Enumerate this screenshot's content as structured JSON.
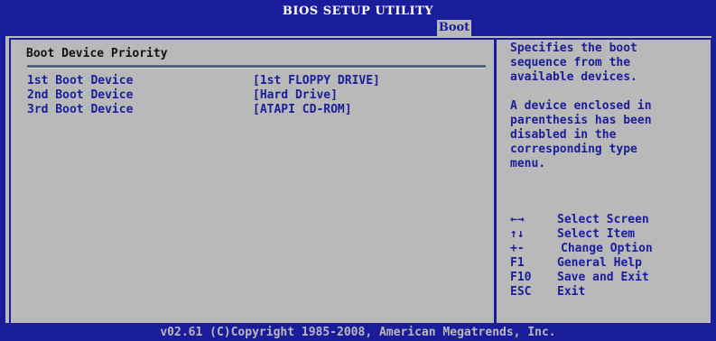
{
  "header": {
    "title": "BIOS SETUP UTILITY",
    "active_tab": "Boot"
  },
  "main": {
    "section_title": "Boot Device Priority",
    "items": [
      {
        "label": "1st Boot Device",
        "value": "[1st FLOPPY DRIVE]"
      },
      {
        "label": "2nd Boot Device",
        "value": "[Hard Drive]"
      },
      {
        "label": "3rd Boot Device",
        "value": "[ATAPI CD-ROM]"
      }
    ]
  },
  "help": {
    "text": "Specifies the boot\nsequence from the\navailable devices.\n\nA device enclosed in\nparenthesis has been\ndisabled in the\ncorresponding type\nmenu."
  },
  "keys": [
    {
      "key": "←→",
      "action": "Select Screen"
    },
    {
      "key": "↑↓",
      "action": "Select Item"
    },
    {
      "key": "+-",
      "action": "Change Option"
    },
    {
      "key": "F1",
      "action": "General Help"
    },
    {
      "key": "F10",
      "action": "Save and Exit"
    },
    {
      "key": "ESC",
      "action": "Exit"
    }
  ],
  "footer": {
    "text": "v02.61 (C)Copyright 1985-2008, American Megatrends, Inc."
  },
  "colors": {
    "background_blue": "#1a1d9a",
    "panel_gray": "#b9b9b9",
    "text_blue": "#1a1d9a"
  }
}
